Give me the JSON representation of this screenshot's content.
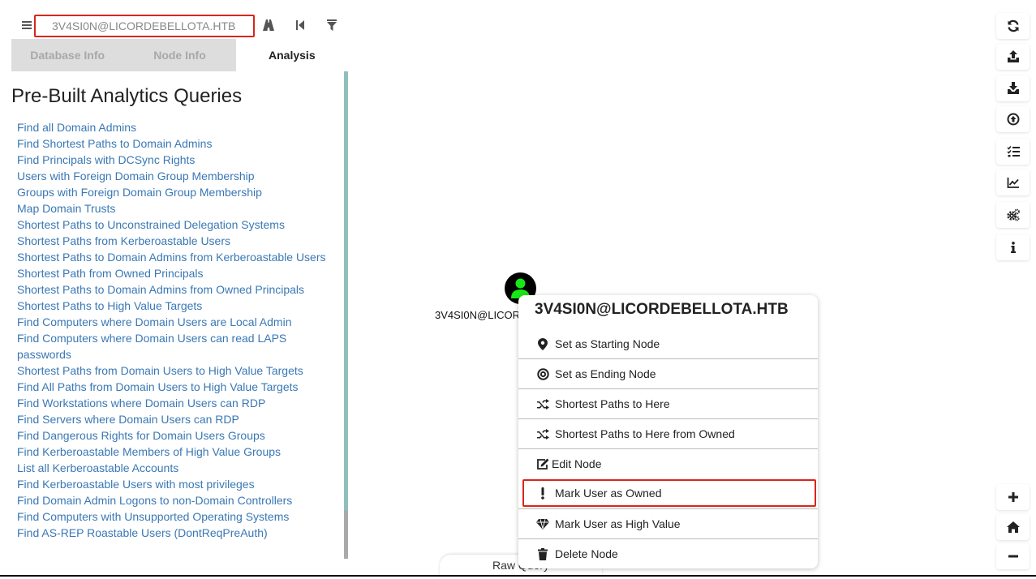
{
  "search": {
    "value": "3V4SI0N@LICORDEBELLOTA.HTB"
  },
  "toolbar_left": {
    "icons": [
      "menu-icon",
      "pathfinding-icon",
      "back-icon",
      "filter-icon"
    ]
  },
  "tabs": [
    {
      "label": "Database Info",
      "active": false
    },
    {
      "label": "Node Info",
      "active": false
    },
    {
      "label": "Analysis",
      "active": true
    }
  ],
  "analysis": {
    "heading": "Pre-Built Analytics Queries",
    "queries": [
      "Find all Domain Admins",
      "Find Shortest Paths to Domain Admins",
      "Find Principals with DCSync Rights",
      "Users with Foreign Domain Group Membership",
      "Groups with Foreign Domain Group Membership",
      "Map Domain Trusts",
      "Shortest Paths to Unconstrained Delegation Systems",
      "Shortest Paths from Kerberoastable Users",
      "Shortest Paths to Domain Admins from Kerberoastable Users",
      "Shortest Path from Owned Principals",
      "Shortest Paths to Domain Admins from Owned Principals",
      "Shortest Paths to High Value Targets",
      "Find Computers where Domain Users are Local Admin",
      "Find Computers where Domain Users can read LAPS passwords",
      "Shortest Paths from Domain Users to High Value Targets",
      "Find All Paths from Domain Users to High Value Targets",
      "Find Workstations where Domain Users can RDP",
      "Find Servers where Domain Users can RDP",
      "Find Dangerous Rights for Domain Users Groups",
      "Find Kerberoastable Members of High Value Groups",
      "List all Kerberoastable Accounts",
      "Find Kerberoastable Users with most privileges",
      "Find Domain Admin Logons to non-Domain Controllers",
      "Find Computers with Unsupported Operating Systems",
      "Find AS-REP Roastable Users (DontReqPreAuth)"
    ]
  },
  "graph": {
    "node_label": "3V4SI0N@LICORDEBELLOTA.HTB",
    "node_color": "#17e817"
  },
  "context_menu": {
    "title": "3V4SI0N@LICORDEBELLOTA.HTB",
    "items": [
      {
        "label": "Set as Starting Node",
        "icon": "map-marker-icon"
      },
      {
        "label": "Set as Ending Node",
        "icon": "bullseye-icon"
      },
      {
        "label": "Shortest Paths to Here",
        "icon": "random-icon"
      },
      {
        "label": "Shortest Paths to Here from Owned",
        "icon": "random-icon"
      },
      {
        "label": "Edit Node",
        "icon": "edit-icon"
      },
      {
        "label": "Mark User as Owned",
        "icon": "exclamation-icon"
      },
      {
        "label": "Mark User as High Value",
        "icon": "gem-icon"
      },
      {
        "label": "Delete Node",
        "icon": "trash-icon"
      }
    ]
  },
  "raw_query": {
    "label": "Raw Query"
  },
  "right_toolbar": {
    "icons": [
      "refresh-icon",
      "upload-icon",
      "download-icon",
      "arrow-circle-up-icon",
      "tasks-icon",
      "chart-line-icon",
      "cogs-icon",
      "info-icon",
      "zoom-in-icon",
      "home-icon",
      "zoom-out-icon"
    ]
  },
  "colors": {
    "highlight_border": "#d9261c",
    "link": "#3a78b4",
    "scrollbar": "#8fbfbd"
  }
}
